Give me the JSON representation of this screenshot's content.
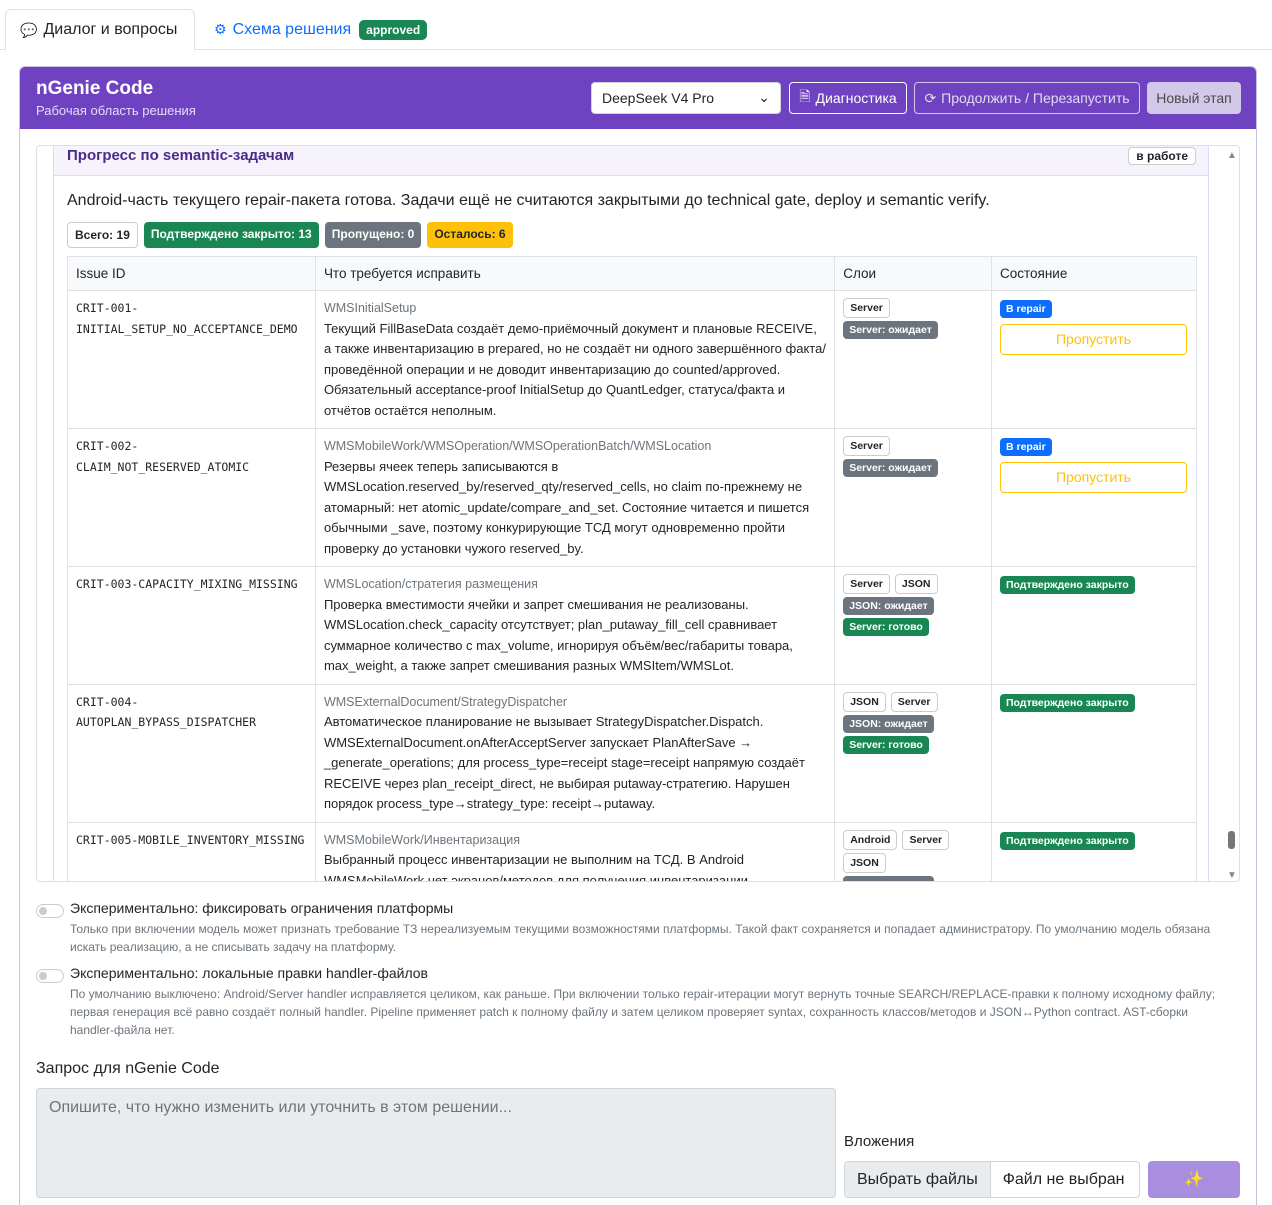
{
  "tabs": {
    "dialog": {
      "icon": "💬",
      "label": "Диалог и вопросы"
    },
    "schema": {
      "icon": "⚙",
      "label": "Схема решения",
      "badge": "approved"
    }
  },
  "header": {
    "title": "nGenie Code",
    "subtitle": "Рабочая область решения",
    "model": "DeepSeek V4 Pro",
    "diagnostics": "Диагностика",
    "continue": "Продолжить / Перезапустить",
    "new_stage": "Новый этап"
  },
  "progress": {
    "title": "Прогресс по semantic-задачам",
    "status": "в работе",
    "description": "Android-часть текущего repair-пакета готова. Задачи ещё не считаются закрытыми до technical gate, deploy и semantic verify.",
    "counts": {
      "total": "Всего: 19",
      "confirmed": "Подтверждено закрыто: 13",
      "skipped": "Пропущено: 0",
      "left": "Осталось: 6"
    },
    "columns": [
      "Issue ID",
      "Что требуется исправить",
      "Слои",
      "Состояние"
    ],
    "rows": [
      {
        "id": "CRIT-001-\nINITIAL_SETUP_NO_ACCEPTANCE_DEMO",
        "path": "WMSInitialSetup",
        "text": "Текущий FillBaseData создаёт демо-приёмочный документ и плановые RECEIVE, а также инвентаризацию в prepared, но не создаёт ни одного завершённого факта/проведённой операции и не доводит инвентаризацию до counted/approved. Обязательный acceptance-proof InitialSetup до QuantLedger, статуса/факта и отчётов остаётся неполным.",
        "layers": [
          "Server"
        ],
        "layer_status": [
          {
            "label": "Server: ожидает",
            "kind": "wait"
          }
        ],
        "state": "В repair",
        "action": "Пропустить"
      },
      {
        "id": "CRIT-002-\nCLAIM_NOT_RESERVED_ATOMIC",
        "path": "WMSMobileWork/WMSOperation/WMSOperationBatch/WMSLocation",
        "text": "Резервы ячеек теперь записываются в WMSLocation.reserved_by/reserved_qty/reserved_cells, но claim по-прежнему не атомарный: нет atomic_update/compare_and_set. Состояние читается и пишется обычными _save, поэтому конкурирующие ТСД могут одновременно пройти проверку до установки чужого reserved_by.",
        "layers": [
          "Server"
        ],
        "layer_status": [
          {
            "label": "Server: ожидает",
            "kind": "wait"
          }
        ],
        "state": "В repair",
        "action": "Пропустить"
      },
      {
        "id": "CRIT-003-CAPACITY_MIXING_MISSING",
        "path": "WMSLocation/стратегия размещения",
        "text": "Проверка вместимости ячейки и запрет смешивания не реализованы. WMSLocation.check_capacity отсутствует; plan_putaway_fill_cell сравнивает суммарное количество с max_volume, игнорируя объём/вес/габариты товара, max_weight, а также запрет смешивания разных WMSItem/WMSLot.",
        "layers": [
          "Server",
          "JSON"
        ],
        "layer_status": [
          {
            "label": "JSON: ожидает",
            "kind": "wait"
          },
          {
            "label": "Server: готово",
            "kind": "ready"
          }
        ],
        "state": "Подтверждено закрыто",
        "action": ""
      },
      {
        "id": "CRIT-004-\nAUTOPLAN_BYPASS_DISPATCHER",
        "path": "WMSExternalDocument/StrategyDispatcher",
        "text": "Автоматическое планирование не вызывает StrategyDispatcher.Dispatch. WMSExternalDocument.onAfterAcceptServer запускает PlanAfterSave → _generate_operations; для process_type=receipt stage=receipt напрямую создаёт RECEIVE через plan_receipt_direct, не выбирая putaway-стратегию. Нарушен порядок process_type→strategy_type: receipt→putaway.",
        "layers": [
          "JSON",
          "Server"
        ],
        "layer_status": [
          {
            "label": "JSON: ожидает",
            "kind": "wait"
          },
          {
            "label": "Server: готово",
            "kind": "ready"
          }
        ],
        "state": "Подтверждено закрыто",
        "action": ""
      },
      {
        "id": "CRIT-005-MOBILE_INVENTORY_MISSING",
        "path": "WMSMobileWork/Инвентаризация",
        "text": "Выбранный процесс инвентаризации не выполним на ТСД. В Android WMSMobileWork нет экранов/методов для получения инвентаризации,",
        "layers": [
          "Android",
          "Server",
          "JSON"
        ],
        "layer_status": [
          {
            "label": "JSON: ожидает",
            "kind": "wait"
          }
        ],
        "state": "Подтверждено закрыто",
        "action": ""
      }
    ]
  },
  "toggles": [
    {
      "label": "Экспериментально: фиксировать ограничения платформы",
      "help": "Только при включении модель может признать требование ТЗ нереализуемым текущими возможностями платформы. Такой факт сохраняется и попадает администратору. По умолчанию модель обязана искать реализацию, а не списывать задачу на платформу."
    },
    {
      "label": "Экспериментально: локальные правки handler-файлов",
      "help": "По умолчанию выключено: Android/Server handler исправляется целиком, как раньше. При включении только repair-итерации могут вернуть точные SEARCH/REPLACE-правки к полному исходному файлу; первая генерация всё равно создаёт полный handler. Pipeline применяет patch к полному файлу и затем целиком проверяет syntax, сохранность классов/методов и JSON↔Python contract. AST-сборки handler-файла нет."
    }
  ],
  "request": {
    "label": "Запрос для nGenie Code",
    "placeholder": "Опишите, что нужно изменить или уточнить в этом решении...",
    "attachments_label": "Вложения",
    "choose_files": "Выбрать файлы",
    "no_file": "Файл не выбран",
    "send_icon": "✨"
  }
}
